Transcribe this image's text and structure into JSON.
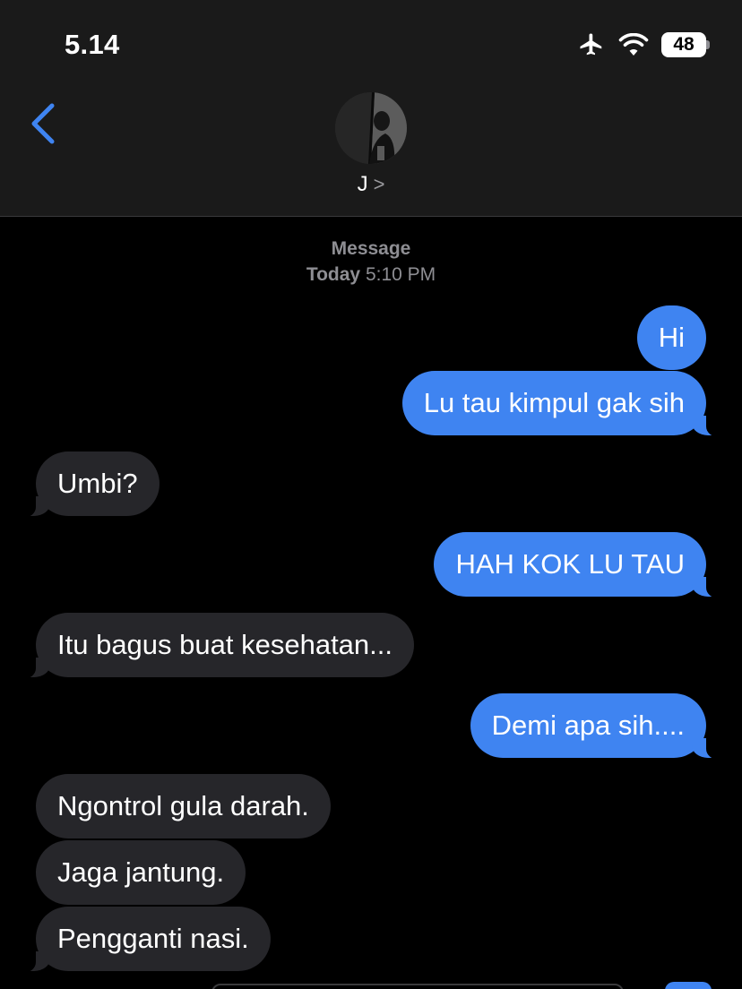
{
  "status_bar": {
    "time": "5.14",
    "battery_level": "48",
    "airplane_mode": true,
    "wifi": true
  },
  "header": {
    "back_icon": "chevron-left-icon",
    "contact_name": "J",
    "contact_chevron": ">"
  },
  "thread": {
    "service_label": "Message",
    "timestamp_day": "Today",
    "timestamp_time": "5:10 PM"
  },
  "messages": [
    {
      "direction": "outgoing",
      "text": "Hi"
    },
    {
      "direction": "outgoing",
      "text": "Lu tau kimpul gak sih"
    },
    {
      "direction": "incoming",
      "text": "Umbi?"
    },
    {
      "direction": "outgoing",
      "text": "HAH KOK LU TAU"
    },
    {
      "direction": "incoming",
      "text": "Itu bagus buat kesehatan..."
    },
    {
      "direction": "outgoing",
      "text": "Demi apa sih...."
    },
    {
      "direction": "incoming",
      "text": "Ngontrol gula darah."
    },
    {
      "direction": "incoming",
      "text": "Jaga jantung."
    },
    {
      "direction": "incoming",
      "text": "Pengganti nasi."
    }
  ],
  "colors": {
    "outgoing_bubble": "#3f84f1",
    "incoming_bubble": "#26262a",
    "background": "#000000",
    "header_background": "#1a1a1a",
    "accent": "#3f84f1"
  }
}
